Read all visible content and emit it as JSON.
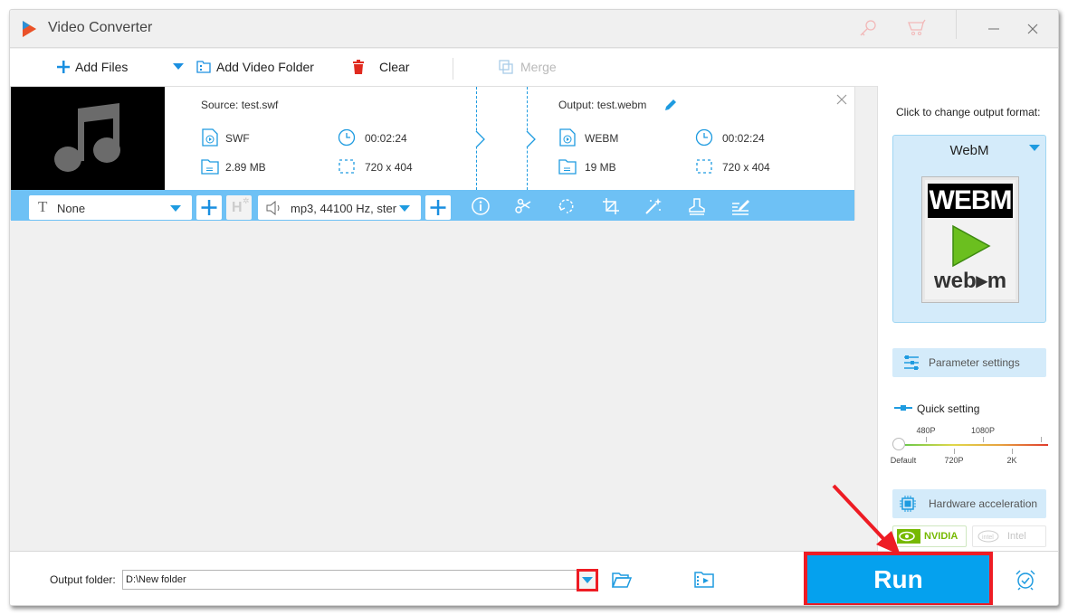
{
  "window": {
    "title": "Video Converter",
    "icons": [
      "key-icon",
      "cart-icon",
      "minimize-icon",
      "close-icon"
    ]
  },
  "toolbar": {
    "add_files": "Add Files",
    "add_video_folder": "Add Video Folder",
    "clear": "Clear",
    "merge": "Merge"
  },
  "file": {
    "source_label": "Source: test.swf",
    "source": {
      "format": "SWF",
      "duration": "00:02:24",
      "size": "2.89 MB",
      "resolution": "720 x 404"
    },
    "output_label": "Output: test.webm",
    "output": {
      "format": "WEBM",
      "duration": "00:02:24",
      "size": "19 MB",
      "resolution": "720 x 404"
    },
    "subtitle_select": "None",
    "audio_select": "mp3, 44100 Hz, ster",
    "edit_tools": [
      "info-icon",
      "cut-icon",
      "rotate-icon",
      "crop-icon",
      "effects-icon",
      "watermark-icon",
      "edit-subtitle-icon"
    ]
  },
  "right_panel": {
    "prompt": "Click to change output format:",
    "format_name": "WebM",
    "format_badge_top": "WEBM",
    "format_badge_bottom": "web▸m",
    "parameter_settings": "Parameter settings",
    "quick_setting": "Quick setting",
    "quality_ticks_top": [
      "480P",
      "1080P"
    ],
    "quality_ticks_bottom": [
      "Default",
      "720P",
      "2K"
    ],
    "quality_value": "Default",
    "hardware_acceleration": "Hardware acceleration",
    "nvidia": "NVIDIA",
    "intel": "Intel",
    "colors": {
      "accent": "#05a1ee",
      "panel_button": "#d4ebfa",
      "nvidia_green": "#76b900"
    }
  },
  "bottom": {
    "output_folder_label": "Output folder:",
    "output_folder_value": "D:\\New folder",
    "run": "Run",
    "highlight_color": "#ee1c24"
  }
}
